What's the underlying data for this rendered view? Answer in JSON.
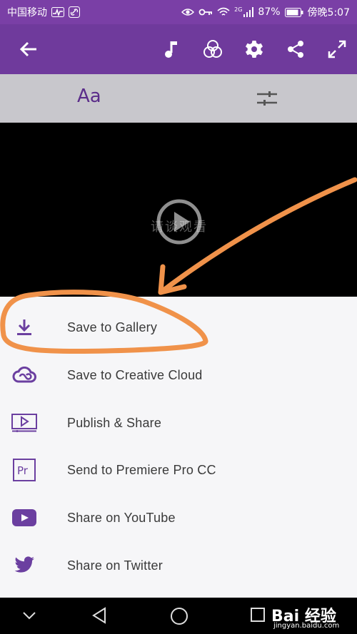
{
  "status_bar": {
    "carrier": "中国移动",
    "battery": "87%",
    "network": "2G",
    "time": "傍晚5:07"
  },
  "app_bar": {
    "icons": [
      "back-arrow-icon",
      "music-note-icon",
      "color-circles-icon",
      "gear-icon",
      "share-icon",
      "expand-icon"
    ]
  },
  "tool_bar": {
    "text_tool": "Aa"
  },
  "video": {
    "watermark": "请谈观看"
  },
  "menu": {
    "items": [
      {
        "label": "Save to Gallery",
        "icon": "download-icon"
      },
      {
        "label": "Save to Creative Cloud",
        "icon": "creative-cloud-icon"
      },
      {
        "label": "Publish & Share",
        "icon": "publish-video-icon"
      },
      {
        "label": "Send to Premiere Pro CC",
        "icon": "premiere-pro-icon"
      },
      {
        "label": "Share on YouTube",
        "icon": "youtube-icon"
      },
      {
        "label": "Share on Twitter",
        "icon": "twitter-icon"
      }
    ]
  },
  "watermark_logo": {
    "brand": "Bai 经验",
    "domain": "jingyan.baidu.com"
  },
  "colors": {
    "accent": "#6f3a9c",
    "icon_purple": "#6b3fa0",
    "annotation_orange": "#f0924a"
  }
}
